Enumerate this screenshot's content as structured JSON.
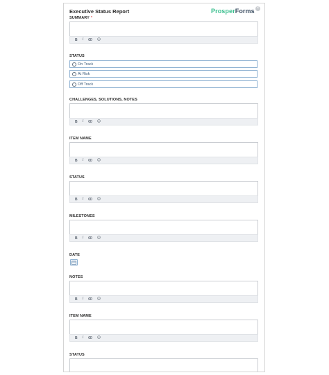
{
  "header": {
    "title": "Executive Status Report",
    "brand_part1": "Prosper",
    "brand_part2": "Forms",
    "close_glyph": "×"
  },
  "toolbar": {
    "bold": "B",
    "italic": "I",
    "link_icon": "link-icon",
    "emoji_icon": "emoji-icon"
  },
  "summary": {
    "label": "SUMMARY",
    "required_mark": "*"
  },
  "status": {
    "label": "STATUS",
    "options": [
      "On Track",
      "At Risk",
      "Off Track"
    ]
  },
  "challenges": {
    "label": "CHALLENGES, SOLUTIONS, NOTES"
  },
  "item_name_1": {
    "label": "ITEM NAME"
  },
  "status_text_1": {
    "label": "STATUS"
  },
  "milestones": {
    "label": "MILESTONES"
  },
  "date": {
    "label": "DATE",
    "icon": "calendar-icon"
  },
  "notes": {
    "label": "NOTES"
  },
  "item_name_2": {
    "label": "ITEM NAME"
  },
  "status_text_2": {
    "label": "STATUS"
  },
  "colors": {
    "brand_green": "#3bbf8f",
    "brand_dark": "#3d4f63",
    "radio_border": "#8fb2d2",
    "required": "#e05656"
  }
}
